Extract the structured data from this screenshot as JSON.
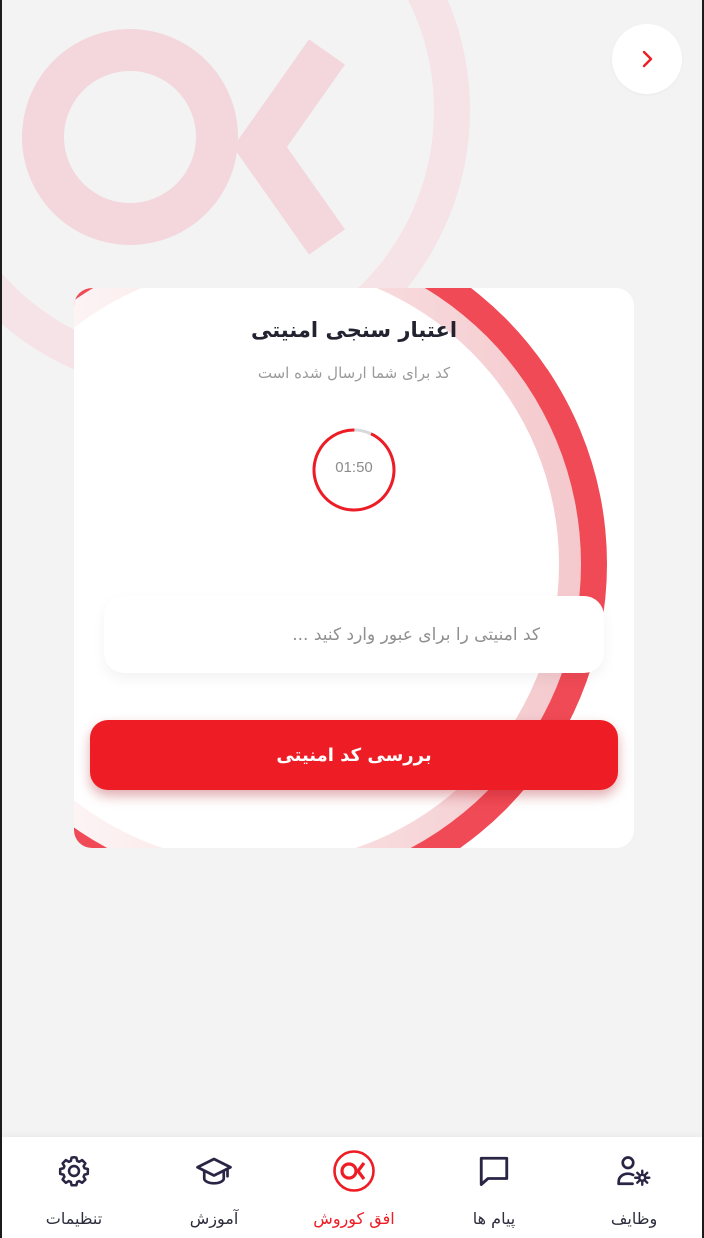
{
  "header": {
    "back_icon": "chevron-right-icon"
  },
  "colors": {
    "accent": "#ee1c25",
    "deco_red": "#ef4a55",
    "logo_watermark": "#f3d7dd",
    "text_dark": "#222230",
    "text_muted": "#9a9a9a",
    "background": "#f3f3f3"
  },
  "card": {
    "title": "اعتبار سنجی امنیتی",
    "subtitle": "کد برای شما ارسال شده است",
    "timer": {
      "label": "01:50",
      "progress": 0.93
    },
    "code_input": {
      "value": "",
      "placeholder": "کد امنیتی را برای عبور وارد کنید ..."
    },
    "submit_label": "بررسی کد امنیتی"
  },
  "bottom_nav": {
    "items": [
      {
        "label": "تنظیمات",
        "icon": "gear-icon",
        "active": false
      },
      {
        "label": "آموزش",
        "icon": "graduation-cap-icon",
        "active": false
      },
      {
        "label": "افق کوروش",
        "icon": "ok-logo-icon",
        "active": true
      },
      {
        "label": "پیام ها",
        "icon": "message-icon",
        "active": false
      },
      {
        "label": "وظایف",
        "icon": "user-settings-icon",
        "active": false
      }
    ]
  }
}
